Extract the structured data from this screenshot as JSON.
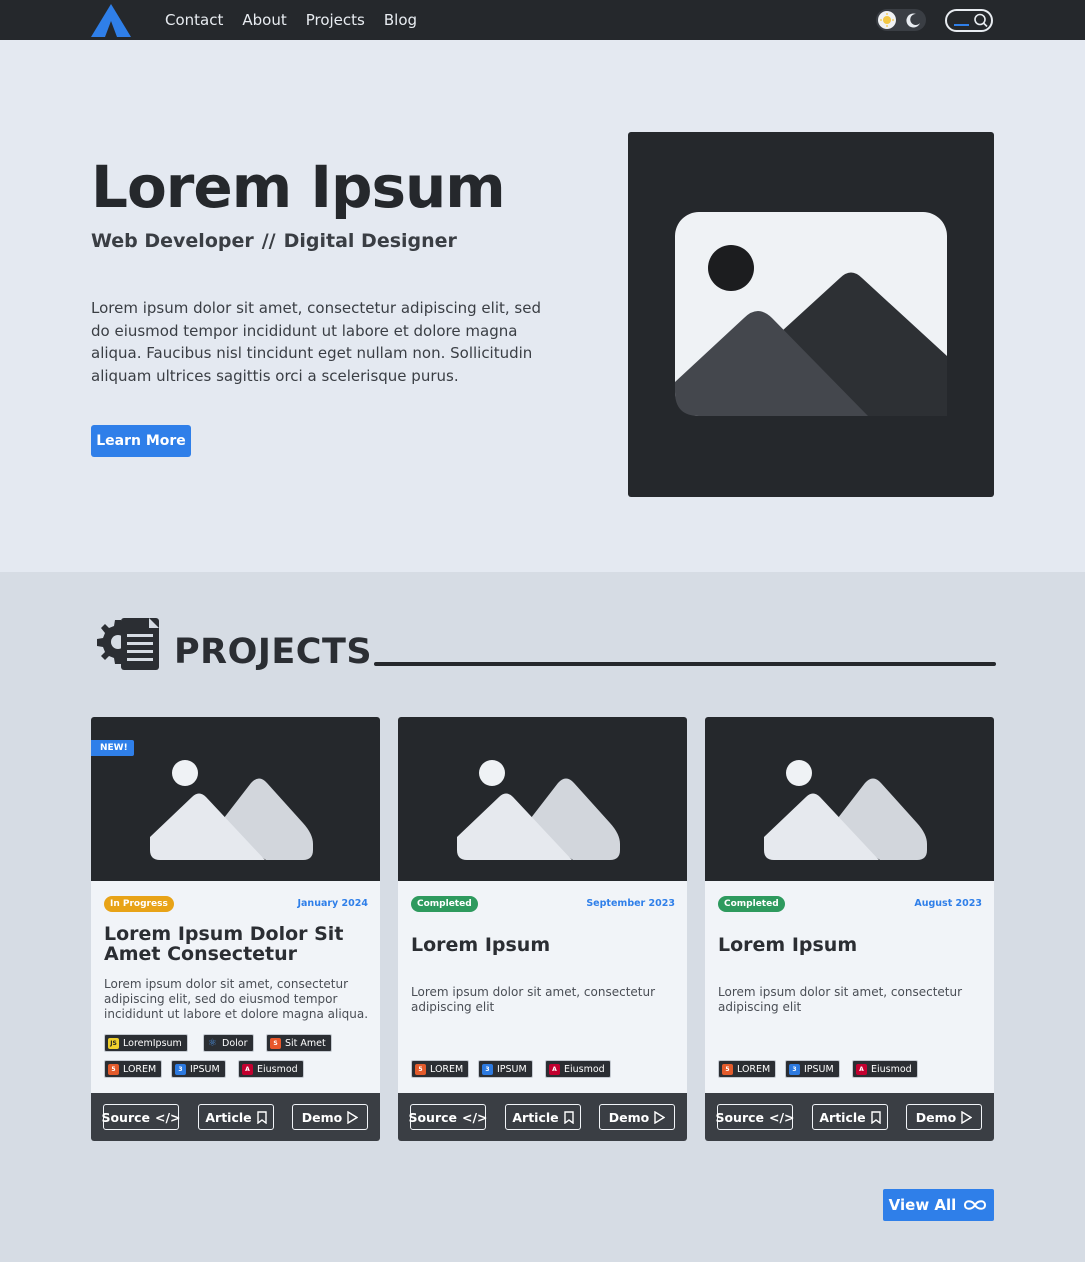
{
  "nav": {
    "links": [
      "Contact",
      "About",
      "Projects",
      "Blog"
    ]
  },
  "hero": {
    "title": "Lorem Ipsum",
    "subtitle_left": "Web Developer",
    "subtitle_sep": "//",
    "subtitle_right": "Digital Designer",
    "text": "Lorem ipsum dolor sit amet, consectetur adipiscing elit, sed do eiusmod tempor incididunt ut labore et dolore magna aliqua. Faucibus nisl tincidunt eget nullam non. Sollicitudin aliquam ultrices sagittis orci a scelerisque purus.",
    "button": "Learn More"
  },
  "projects": {
    "heading": "PROJECTS",
    "cards": [
      {
        "badge": "NEW!",
        "status": "In Progress",
        "date": "January 2024",
        "title": "Lorem Ipsum Dolor Sit Amet Consectetur",
        "desc": "Lorem ipsum dolor sit amet, consectetur adipiscing elit, sed do eiusmod tempor incididunt ut labore et dolore magna aliqua.",
        "tags_row1": [
          "LoremIpsum",
          "Dolor",
          "Sit Amet"
        ],
        "tags_row2": [
          "LOREM",
          "IPSUM",
          "Eiusmod"
        ]
      },
      {
        "status": "Completed",
        "date": "September 2023",
        "title": "Lorem Ipsum",
        "desc": "Lorem ipsum dolor sit amet, consectetur adipiscing elit",
        "tags_row2": [
          "LOREM",
          "IPSUM",
          "Eiusmod"
        ]
      },
      {
        "status": "Completed",
        "date": "August 2023",
        "title": "Lorem Ipsum",
        "desc": "Lorem ipsum dolor sit amet, consectetur adipiscing elit",
        "tags_row2": [
          "LOREM",
          "IPSUM",
          "Eiusmod"
        ]
      }
    ],
    "buttons": {
      "source": "Source",
      "article": "Article",
      "demo": "Demo"
    },
    "view_all": "View All"
  },
  "colors": {
    "accent": "#2f7fe9",
    "dark": "#25282c",
    "in_progress": "#e8a317",
    "completed": "#2e9a5e"
  },
  "icons": {
    "logo": "logo-triangle-icon",
    "theme_light": "sun-icon",
    "theme_dark": "moon-icon",
    "search": "search-icon",
    "section": "gear-document-icon",
    "source": "code-icon",
    "article": "bookmark-icon",
    "demo": "play-icon",
    "view_all": "infinity-icon",
    "placeholder": "image-placeholder-icon"
  }
}
